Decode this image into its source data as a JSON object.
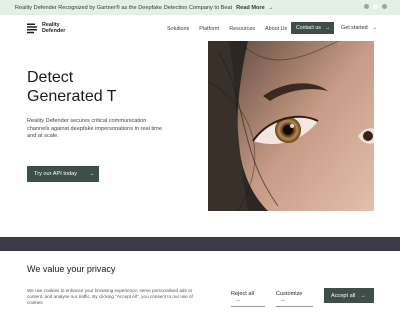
{
  "banner": {
    "text": "Reality Defender Recognized by Gartner® as the Deepfake Detection Company to Beat",
    "read_more": "Read More",
    "arrow": "→"
  },
  "nav": {
    "logo_line1": "Reality",
    "logo_line2": "Defender",
    "links": [
      "Solutions",
      "Platform",
      "Resources",
      "About Us"
    ],
    "contact": "Contact us",
    "get_started": "Get started",
    "arrow": "→"
  },
  "hero": {
    "title_line1": "Detect",
    "title_line2": "Generated T",
    "description": "Reality Defender secures critical communication channels against deepfake impersonations in real time and at scale.",
    "cta": "Try our API today",
    "arrow": "→"
  },
  "cookie": {
    "title": "We value your privacy",
    "text": "We use cookies to enhance your browsing experience, serve personalised ads or content, and analyse our traffic. By clicking \"Accept All\", you consent to our use of cookies.",
    "reject": "Reject all",
    "customize": "Customize",
    "accept": "Accept all",
    "arrow": "→"
  },
  "colors": {
    "banner_bg": "#e3f0e6",
    "button_bg": "#3d4f48",
    "dark_band": "#3c3d48"
  }
}
